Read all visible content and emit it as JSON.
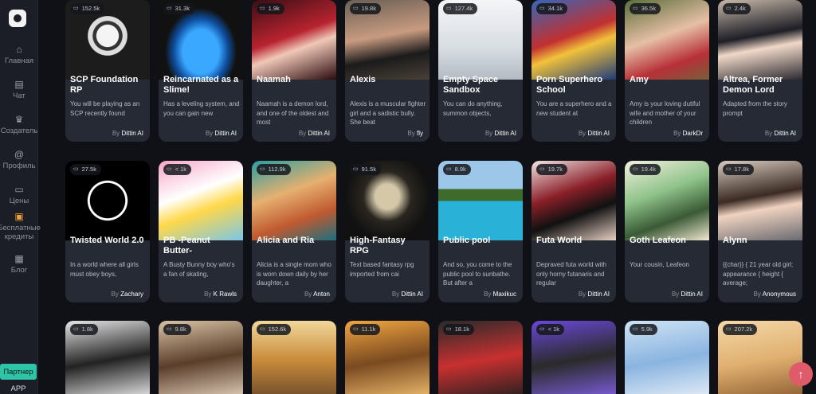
{
  "sidebar": {
    "items": [
      {
        "label": "Главная",
        "icon": "home-icon",
        "glyph": "⌂"
      },
      {
        "label": "Чат",
        "icon": "chat-icon",
        "glyph": "▤"
      },
      {
        "label": "Создатель",
        "icon": "creator-icon",
        "glyph": "♛"
      },
      {
        "label": "Профиль",
        "icon": "profile-icon",
        "glyph": "@"
      },
      {
        "label": "Цены",
        "icon": "pricing-icon",
        "glyph": "▭"
      },
      {
        "label": "Бесплатные кредиты",
        "icon": "gift-icon",
        "glyph": "▣"
      },
      {
        "label": "Блог",
        "icon": "blog-icon",
        "glyph": "▦"
      }
    ],
    "partner_label": "Партнер",
    "app_label": "APP"
  },
  "cards": [
    {
      "count": "152.5k",
      "title": "SCP Foundation RP",
      "desc": "You will be playing as an SCP recently found",
      "author": "Dittin AI",
      "img": "img-scp"
    },
    {
      "count": "31.3k",
      "title": "Reincarnated as a Slime!",
      "desc": "Has a leveling system, and you can gain new",
      "author": "Dittin AI",
      "img": "img-slime"
    },
    {
      "count": "1.9k",
      "title": "Naamah",
      "desc": "Naamah is a demon lord, and one of the oldest and most",
      "author": "Dittin AI",
      "img": "img-naamah"
    },
    {
      "count": "19.8k",
      "title": "Alexis",
      "desc": "Alexis is a muscular fighter girl and a sadistic bully. She beat",
      "author": "fly",
      "img": "img-alexis"
    },
    {
      "count": "127.4k",
      "title": "Empty Space Sandbox",
      "desc": "You can do anything, summon objects,",
      "author": "Dittin AI",
      "img": "img-empty"
    },
    {
      "count": "34.1k",
      "title": "Porn Superhero School",
      "desc": "You are a superhero and a new student at",
      "author": "Dittin AI",
      "img": "img-superhero"
    },
    {
      "count": "36.5k",
      "title": "Amy",
      "desc": "Amy is your loving dutiful wife and mother of your children",
      "author": "DarkDr",
      "img": "img-amy"
    },
    {
      "count": "2.4k",
      "title": "Altrea, Former Demon Lord",
      "desc": "Adapted from the story prompt",
      "author": "Dittin AI",
      "img": "img-altrea"
    },
    {
      "count": "27.5k",
      "title": "Twisted World 2.0",
      "desc": "In a world where all girls must obey boys,",
      "author": "Zachary",
      "img": "img-twisted"
    },
    {
      "count": "< 1k",
      "title": "PB -Peanut Butter-",
      "desc": "A Busty Bunny boy who's a fan of skating,",
      "author": "K Rawls",
      "img": "img-pb"
    },
    {
      "count": "112.9k",
      "title": "Alicia and Ria",
      "desc": "Alicia is a single mom who is worn down daily by her daughter, a",
      "author": "Anton",
      "img": "img-alicia"
    },
    {
      "count": "91.5k",
      "title": "High-Fantasy RPG",
      "desc": "Text based fantasy rpg imported from cai",
      "author": "Dittin AI",
      "img": "img-fantasy"
    },
    {
      "count": "8.9k",
      "title": "Public pool",
      "desc": "And so, you come to the public pool to sunbathe. But after a",
      "author": "Maxikuc",
      "img": "img-pool"
    },
    {
      "count": "19.7k",
      "title": "Futa World",
      "desc": "Depraved futa world with only horny futanaris and regular",
      "author": "Dittin AI",
      "img": "img-futa"
    },
    {
      "count": "19.4k",
      "title": "Goth Leafeon",
      "desc": "Your cousin, Leafeon",
      "author": "Dittin AI",
      "img": "img-leafeon"
    },
    {
      "count": "17.8k",
      "title": "Alynn",
      "desc": "{{char}} { 21 year old girl; appearance { height { average;",
      "author": "Anonymous",
      "img": "img-alynn"
    },
    {
      "count": "1.8k",
      "title": "",
      "desc": "",
      "author": "",
      "img": "img-r3-1"
    },
    {
      "count": "9.8k",
      "title": "",
      "desc": "",
      "author": "",
      "img": "img-r3-2"
    },
    {
      "count": "152.6k",
      "title": "",
      "desc": "",
      "author": "",
      "img": "img-r3-3"
    },
    {
      "count": "11.1k",
      "title": "",
      "desc": "",
      "author": "",
      "img": "img-r3-4"
    },
    {
      "count": "18.1k",
      "title": "",
      "desc": "",
      "author": "",
      "img": "img-r3-5"
    },
    {
      "count": "< 1k",
      "title": "",
      "desc": "",
      "author": "",
      "img": "img-r3-6"
    },
    {
      "count": "5.9k",
      "title": "",
      "desc": "",
      "author": "",
      "img": "img-r3-7"
    },
    {
      "count": "207.2k",
      "title": "",
      "desc": "",
      "author": "",
      "img": "img-r3-8"
    }
  ],
  "by_label": "By",
  "scroll_top_icon": "arrow-up-icon",
  "colors": {
    "accent": "#2ec4a7",
    "scroll_top": "#e05b6a",
    "card_bg": "#262a35",
    "page_bg": "#0f1117"
  }
}
